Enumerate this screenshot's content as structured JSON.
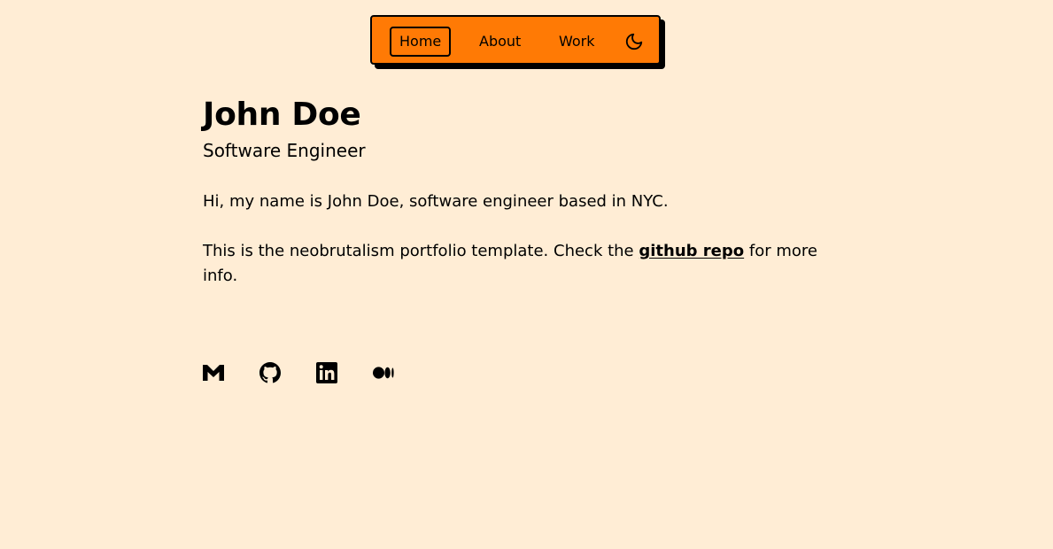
{
  "nav": {
    "items": [
      {
        "label": "Home",
        "active": true
      },
      {
        "label": "About",
        "active": false
      },
      {
        "label": "Work",
        "active": false
      }
    ],
    "theme_toggle_icon": "moon-icon"
  },
  "profile": {
    "name": "John Doe",
    "role": "Software Engineer",
    "intro": "Hi, my name is John Doe, software engineer based in NYC.",
    "template_text_before": "This is the neobrutalism portfolio template. Check the ",
    "repo_link_label": "github repo",
    "template_text_after": " for more info."
  },
  "socials": [
    {
      "icon": "gmail-icon"
    },
    {
      "icon": "github-icon"
    },
    {
      "icon": "linkedin-icon"
    },
    {
      "icon": "medium-icon"
    }
  ],
  "colors": {
    "background": "#ffedd5",
    "accent": "#ff7a05",
    "text": "#000000"
  }
}
